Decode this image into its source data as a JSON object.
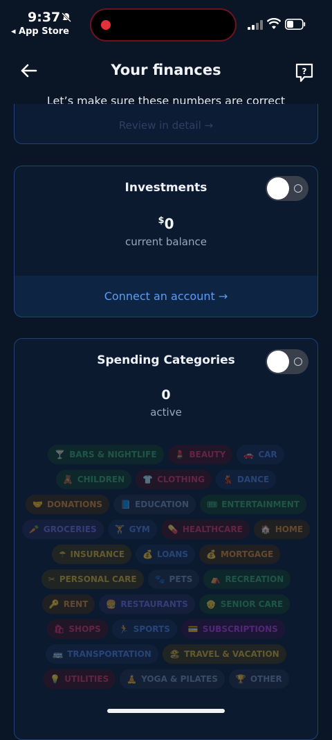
{
  "status_bar": {
    "time": "9:37",
    "back_app": "◂ App Store"
  },
  "header": {
    "title": "Your finances",
    "subtitle": "Let’s make sure these numbers are correct"
  },
  "top_card": {
    "link": "Review in detail"
  },
  "investments": {
    "title": "Investments",
    "currency": "$",
    "balance": "0",
    "caption": "current balance",
    "connect": "Connect an account",
    "toggle_on": false
  },
  "spending": {
    "title": "Spending Categories",
    "count": "0",
    "caption": "active",
    "toggle_on": false,
    "categories": [
      {
        "label": "BARS & NIGHTLIFE",
        "icon": "cocktail-icon",
        "glyph": "🍸",
        "color": "#3aa866",
        "bg": "#133a26"
      },
      {
        "label": "BEAUTY",
        "icon": "lipstick-icon",
        "glyph": "💄",
        "color": "#d8335b",
        "bg": "#40121f"
      },
      {
        "label": "CAR",
        "icon": "car-icon",
        "glyph": "🚗",
        "color": "#4f7fd6",
        "bg": "#17284a"
      },
      {
        "label": "CHILDREN",
        "icon": "child-icon",
        "glyph": "🧸",
        "color": "#3aa866",
        "bg": "#133a26"
      },
      {
        "label": "CLOTHING",
        "icon": "shirt-icon",
        "glyph": "👕",
        "color": "#d8335b",
        "bg": "#40121f"
      },
      {
        "label": "DANCE",
        "icon": "dance-icon",
        "glyph": "💃",
        "color": "#4f7fd6",
        "bg": "#17284a"
      },
      {
        "label": "DONATIONS",
        "icon": "heart-hand-icon",
        "glyph": "🤝",
        "color": "#d88a2d",
        "bg": "#3d2a12"
      },
      {
        "label": "EDUCATION",
        "icon": "book-icon",
        "glyph": "📘",
        "color": "#7b8fb2",
        "bg": "#1f2a40"
      },
      {
        "label": "ENTERTAINMENT",
        "icon": "ticket-icon",
        "glyph": "🎟",
        "color": "#3aa866",
        "bg": "#133a26"
      },
      {
        "label": "GROCERIES",
        "icon": "carrot-icon",
        "glyph": "🥕",
        "color": "#6b6ed8",
        "bg": "#22244a"
      },
      {
        "label": "GYM",
        "icon": "dumbbell-icon",
        "glyph": "🏋",
        "color": "#4f7fd6",
        "bg": "#17284a"
      },
      {
        "label": "HEALTHCARE",
        "icon": "pill-icon",
        "glyph": "💊",
        "color": "#d8335b",
        "bg": "#40121f"
      },
      {
        "label": "HOME",
        "icon": "house-icon",
        "glyph": "🏠",
        "color": "#d88a2d",
        "bg": "#3d2a12"
      },
      {
        "label": "INSURANCE",
        "icon": "umbrella-icon",
        "glyph": "☂",
        "color": "#d8b22d",
        "bg": "#3d3412"
      },
      {
        "label": "LOANS",
        "icon": "money-bag-icon",
        "glyph": "💰",
        "color": "#4f7fd6",
        "bg": "#17284a"
      },
      {
        "label": "MORTGAGE",
        "icon": "money-bag-icon",
        "glyph": "💰",
        "color": "#d88a2d",
        "bg": "#3d2a12"
      },
      {
        "label": "PERSONAL CARE",
        "icon": "scissors-icon",
        "glyph": "✂",
        "color": "#d8b22d",
        "bg": "#3d3412"
      },
      {
        "label": "PETS",
        "icon": "paw-icon",
        "glyph": "🐾",
        "color": "#7b8fb2",
        "bg": "#1f2a40"
      },
      {
        "label": "RECREATION",
        "icon": "camp-icon",
        "glyph": "⛺",
        "color": "#3aa866",
        "bg": "#133a26"
      },
      {
        "label": "RENT",
        "icon": "key-icon",
        "glyph": "🔑",
        "color": "#d88a2d",
        "bg": "#3d2a12"
      },
      {
        "label": "RESTAURANTS",
        "icon": "burger-icon",
        "glyph": "🍔",
        "color": "#6b6ed8",
        "bg": "#22244a"
      },
      {
        "label": "SENIOR CARE",
        "icon": "senior-icon",
        "glyph": "👴",
        "color": "#3aa866",
        "bg": "#133a26"
      },
      {
        "label": "SHOPS",
        "icon": "shopping-bag-icon",
        "glyph": "🛍",
        "color": "#d8335b",
        "bg": "#40121f"
      },
      {
        "label": "SPORTS",
        "icon": "runner-icon",
        "glyph": "🏃",
        "color": "#4f7fd6",
        "bg": "#17284a"
      },
      {
        "label": "SUBSCRIPTIONS",
        "icon": "card-icon",
        "glyph": "💳",
        "color": "#b03ad8",
        "bg": "#34123f"
      },
      {
        "label": "TRANSPORTATION",
        "icon": "bus-icon",
        "glyph": "🚌",
        "color": "#4f7fd6",
        "bg": "#17284a"
      },
      {
        "label": "TRAVEL & VACATION",
        "icon": "beach-icon",
        "glyph": "🏖",
        "color": "#d8b22d",
        "bg": "#3d3412"
      },
      {
        "label": "UTILITIES",
        "icon": "bulb-icon",
        "glyph": "💡",
        "color": "#d8335b",
        "bg": "#40121f"
      },
      {
        "label": "YOGA & PILATES",
        "icon": "yoga-icon",
        "glyph": "🧘",
        "color": "#7b8fb2",
        "bg": "#1f2a40"
      },
      {
        "label": "OTHER",
        "icon": "other-icon",
        "glyph": "🏆",
        "color": "#7b8fb2",
        "bg": "#1f2a40"
      }
    ]
  },
  "colors": {
    "background": "#0a1526",
    "card_border": "#1d4474",
    "link": "#5e9cf2"
  }
}
